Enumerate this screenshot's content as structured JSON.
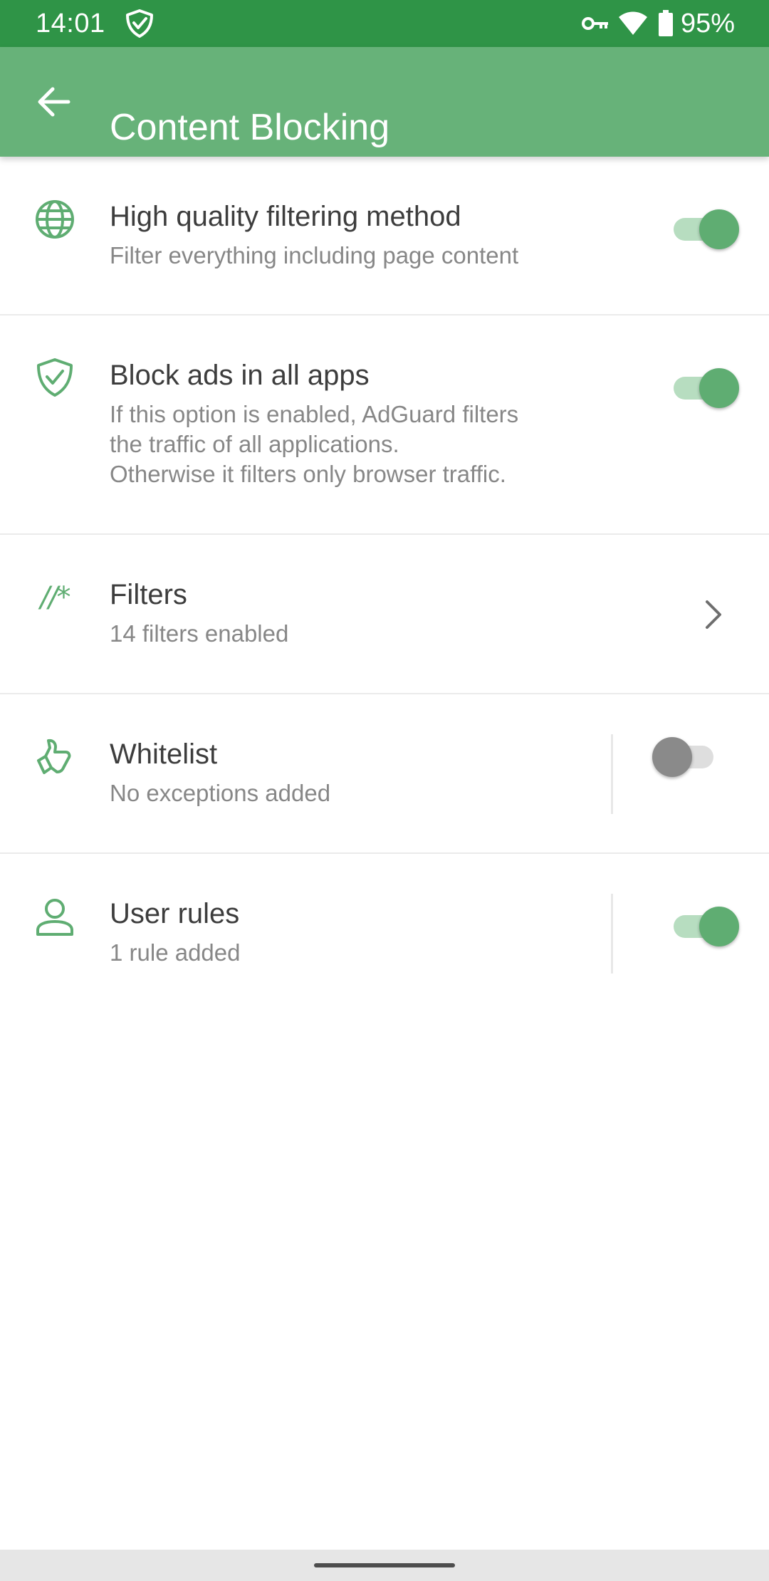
{
  "status_bar": {
    "time": "14:01",
    "icons": [
      "shield-check-icon",
      "vpn-key-icon",
      "wifi-icon",
      "battery-icon"
    ],
    "battery": "95%"
  },
  "app_bar": {
    "back_icon": "arrow-left-icon",
    "title": "Content Blocking"
  },
  "settings": [
    {
      "icon": "globe-icon",
      "title": "High quality filtering method",
      "subtitle_lines": [
        "Filter everything including page content"
      ],
      "control": "toggle",
      "enabled": true
    },
    {
      "icon": "shield-check-icon",
      "title": "Block ads in all apps",
      "subtitle_lines": [
        "If this option is enabled, AdGuard filters",
        "the traffic of all applications.",
        "Otherwise it filters only browser traffic."
      ],
      "control": "toggle",
      "enabled": true
    },
    {
      "icon": "filter-rules-icon",
      "icon_text": "//*",
      "title": "Filters",
      "subtitle_lines": [
        "14 filters enabled"
      ],
      "control": "chevron"
    },
    {
      "icon": "thumbs-up-icon",
      "title": "Whitelist",
      "subtitle_lines": [
        "No exceptions added"
      ],
      "control": "toggle",
      "enabled": false
    },
    {
      "icon": "user-icon",
      "title": "User rules",
      "subtitle_lines": [
        "1 rule added"
      ],
      "control": "toggle",
      "enabled": true
    }
  ],
  "colors": {
    "status_bar": "#2f9447",
    "app_bar": "#67b279",
    "accent": "#5fad72",
    "toggle_on_track": "#b7ddc0",
    "toggle_off_thumb": "#8a8a8a",
    "toggle_off_track": "#dedede"
  }
}
